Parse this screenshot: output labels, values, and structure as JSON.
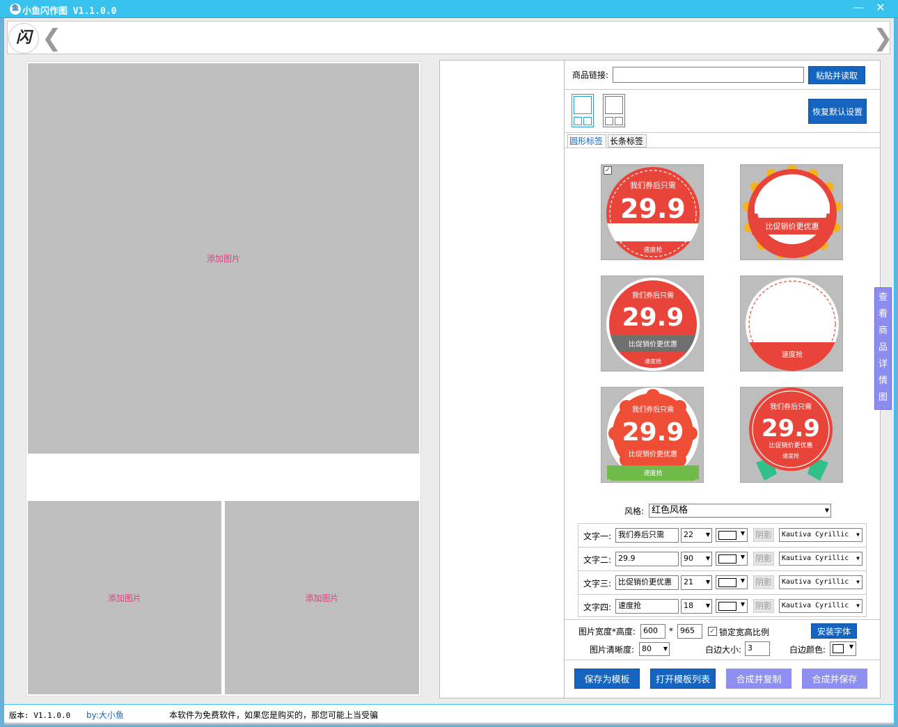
{
  "window": {
    "title": "小鱼闪作图 V1.1.0.0",
    "minimize_icon": "minimize-icon",
    "close_icon": "close-icon"
  },
  "toolbar": {
    "logo_text": "闪",
    "prev_arrow": "❮",
    "next_arrow": "❯"
  },
  "canvas": {
    "top_placeholder": "添加图片",
    "bottom_left_placeholder": "添加图片",
    "bottom_right_placeholder": "添加图片"
  },
  "product": {
    "link_label": "商品链接:",
    "link_value": "",
    "paste_button": "粘贴并读取",
    "restore_button": "恢复默认设置"
  },
  "tabs": [
    "圆形标签",
    "长条标签"
  ],
  "badges": {
    "line1": "我们券后只需",
    "price": "29.9",
    "line3": "比促销价更优惠",
    "line4": "速度抢",
    "selected_index": 0
  },
  "style": {
    "label": "风格:",
    "value": "红色风格"
  },
  "text_rows": [
    {
      "label": "文字一:",
      "value": "我们券后只需",
      "size": "22",
      "shadow": "阴影",
      "font": "Kautiva Cyrillic"
    },
    {
      "label": "文字二:",
      "value": "29.9",
      "size": "90",
      "shadow": "阴影",
      "font": "Kautiva Cyrillic"
    },
    {
      "label": "文字三:",
      "value": "比促销价更优惠",
      "size": "21",
      "shadow": "阴影",
      "font": "Kautiva Cyrillic"
    },
    {
      "label": "文字四:",
      "value": "速度抢",
      "size": "18",
      "shadow": "阴影",
      "font": "Kautiva Cyrillic"
    }
  ],
  "image": {
    "size_label": "图片宽度*高度:",
    "width": "600",
    "times": "*",
    "height": "965",
    "lock_label": "锁定宽高比例",
    "lock_checked": true,
    "install_font_button": "安装字体",
    "quality_label": "图片清晰度:",
    "quality": "80",
    "border_size_label": "白边大小:",
    "border_size": "3",
    "border_color_label": "白边颜色:"
  },
  "actions": {
    "save_template": "保存为模板",
    "open_template_list": "打开模板列表",
    "compose_copy": "合成并复制",
    "compose_save": "合成并保存"
  },
  "side_tab": [
    "查",
    "看",
    "商",
    "品",
    "详",
    "情",
    "图"
  ],
  "status": {
    "version": "版本: V1.1.0.0",
    "author": "by:大小鱼",
    "notice": "本软件为免费软件，如果您是购买的，那您可能上当受骗"
  },
  "colors": {
    "titlebar": "#38c3ee",
    "blue_button": "#1565c0",
    "purple_button": "#8f8ff2",
    "badge_red": "#e8443a",
    "placeholder_text": "#e0407e"
  }
}
